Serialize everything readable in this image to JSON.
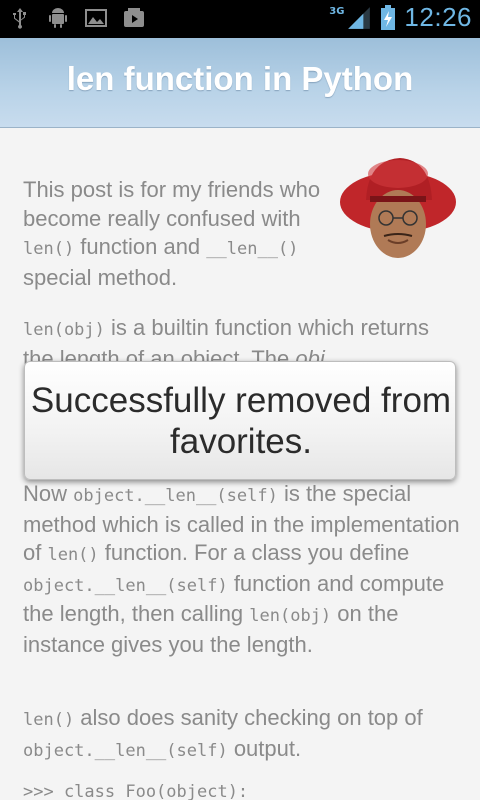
{
  "status_bar": {
    "network": "3G",
    "time": "12:26",
    "icons": [
      "usb-icon",
      "android-debug-icon",
      "gallery-icon",
      "media-play-icon",
      "signal-icon",
      "battery-charging-icon"
    ]
  },
  "header": {
    "title": "len function in Python"
  },
  "post": {
    "p1": {
      "t1": "This post is for my friends who become really confused with ",
      "c1": "len()",
      "t2": " function and ",
      "c2": "__len__()",
      "t3": " special method."
    },
    "p2": {
      "c1": "len(obj)",
      "t1": " is a builtin function which returns the length of an object. The ",
      "e1": "obj"
    },
    "p3": {
      "t1": "Now ",
      "c1": "object.__len__(self)",
      "t2": " is the special method which is called in the implementation of ",
      "c2": "len()",
      "t3": " function. For a class you define ",
      "c3": "object.__len__(self)",
      "t4": " function and compute the length, then calling ",
      "c4": "len(obj)",
      "t5": " on the instance gives you the length."
    },
    "p4": {
      "c1": "len()",
      "t1": " also does sanity checking on top of ",
      "c2": "object.__len__(self)",
      "t2": " output."
    },
    "code_line": ">>> class Foo(object):"
  },
  "toast": {
    "message": "Successfully removed from favorites."
  }
}
